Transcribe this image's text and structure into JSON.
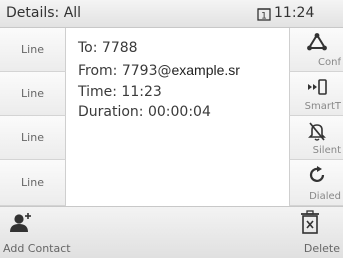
{
  "header": {
    "title": "Details: All",
    "line_indicator": "1",
    "time": "11:24"
  },
  "line_keys": [
    "Line",
    "Line",
    "Line",
    "Line"
  ],
  "details": {
    "to": "To: 7788",
    "from_prefix": "From: 7793@",
    "from_domain": "example.sr",
    "time": "Time: 11:23",
    "duration": "Duration: 00:00:04"
  },
  "soft_keys": [
    {
      "label": "Conf",
      "icon": "conference-icon"
    },
    {
      "label": "SmartT",
      "icon": "smart-transfer-icon"
    },
    {
      "label": "Silent",
      "icon": "silent-bell-icon"
    },
    {
      "label": "Dialed",
      "icon": "redial-icon"
    }
  ],
  "footer": {
    "add_contact": "Add Contact",
    "delete": "Delete"
  },
  "colors": {
    "icon": "#333333",
    "label": "#888888",
    "background": "#ffffff"
  }
}
